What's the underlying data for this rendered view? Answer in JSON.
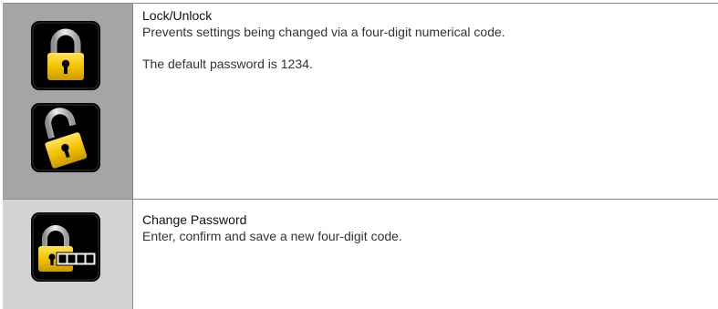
{
  "rows": [
    {
      "title": "Lock/Unlock",
      "description": "Prevents settings being changed via a four-digit numerical code.",
      "note": "The default password is 1234.",
      "icons": [
        "padlock-locked-icon",
        "padlock-unlocked-icon"
      ]
    },
    {
      "title": "Change Password",
      "description": "Enter, confirm and save a new four-digit code.",
      "icons": [
        "padlock-password-icon"
      ]
    }
  ],
  "colors": {
    "icon_cell_row1": "#a5a5a5",
    "icon_cell_row2": "#d3d3d3",
    "tile_background": "#000000",
    "padlock_body": "#f2c200",
    "padlock_shackle": "#c8c8c8",
    "divider": "#8a8a8a"
  }
}
